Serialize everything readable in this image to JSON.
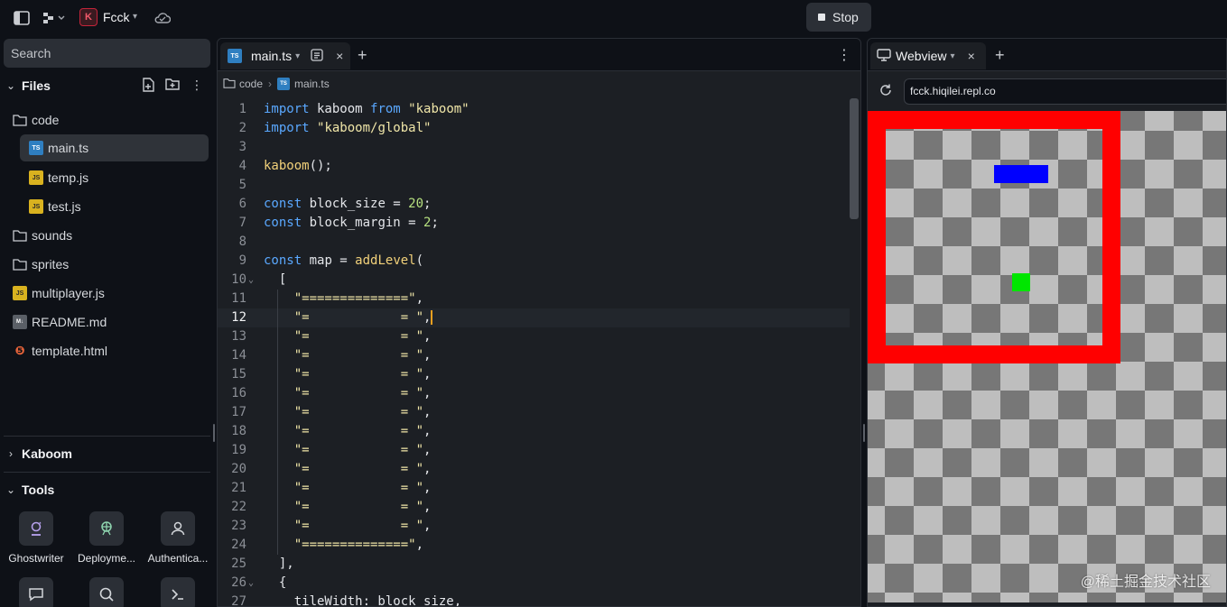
{
  "app": {
    "name": "Fcck",
    "stop_label": "Stop",
    "logo_letter": "K"
  },
  "sidebar": {
    "search_placeholder": "Search",
    "files_title": "Files",
    "tree": [
      {
        "label": "code",
        "icon": "folder-icon",
        "type": "folder"
      },
      {
        "label": "main.ts",
        "icon": "ts-file-icon",
        "type": "ts",
        "selected": true
      },
      {
        "label": "temp.js",
        "icon": "js-file-icon",
        "type": "js"
      },
      {
        "label": "test.js",
        "icon": "js-file-icon",
        "type": "js"
      },
      {
        "label": "sounds",
        "icon": "folder-icon",
        "type": "folder"
      },
      {
        "label": "sprites",
        "icon": "folder-icon",
        "type": "folder"
      },
      {
        "label": "multiplayer.js",
        "icon": "js-file-icon",
        "type": "js"
      },
      {
        "label": "README.md",
        "icon": "md-file-icon",
        "type": "md"
      },
      {
        "label": "template.html",
        "icon": "html-file-icon",
        "type": "html"
      }
    ],
    "kaboom_title": "Kaboom",
    "tools_title": "Tools",
    "tools": [
      {
        "label": "Ghostwriter",
        "icon": "ghostwriter-icon"
      },
      {
        "label": "Deployme...",
        "icon": "deployments-icon"
      },
      {
        "label": "Authentica...",
        "icon": "user-icon"
      },
      {
        "label": "",
        "icon": "chat-icon"
      },
      {
        "label": "",
        "icon": "search-icon"
      },
      {
        "label": "",
        "icon": "shell-icon"
      }
    ]
  },
  "editor": {
    "tab_label": "main.ts",
    "tab_icon_text": "TS",
    "breadcrumb": [
      "code",
      "main.ts"
    ],
    "active_line": 12
  },
  "webview": {
    "tab_label": "Webview",
    "url": "fcck.hiqilei.repl.co"
  },
  "watermark": "@稀土掘金技术社区",
  "colors": {
    "wall": "#ff0000",
    "paddle": "#0000ff",
    "ball": "#00e600"
  }
}
